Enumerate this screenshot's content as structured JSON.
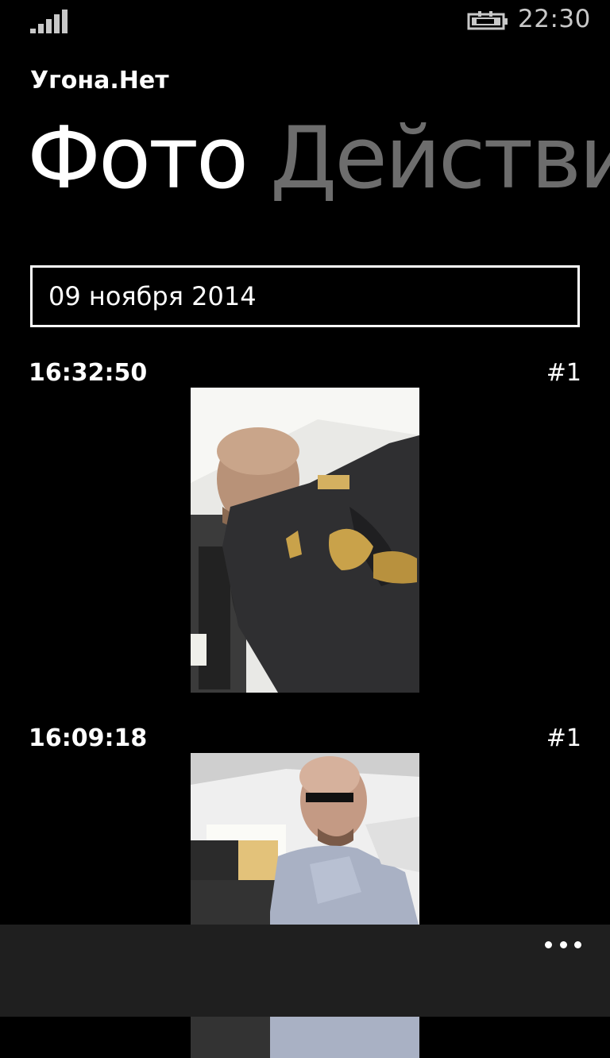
{
  "status": {
    "time": "22:30",
    "signal_icon": "signal-strength-icon",
    "battery_icon": "battery-charging-icon"
  },
  "app": {
    "title": "Угона.Нет"
  },
  "pivot": {
    "items": [
      {
        "label": "Фото",
        "active": true
      },
      {
        "label": "Действия",
        "active": false
      }
    ]
  },
  "date_picker": {
    "value": "09 ноября 2014"
  },
  "entries": [
    {
      "time": "16:32:50",
      "number": "#1",
      "photo_icon": "photo-thumbnail"
    },
    {
      "time": "16:09:18",
      "number": "#1",
      "photo_icon": "photo-thumbnail"
    }
  ],
  "app_bar": {
    "more_icon": "ellipsis-icon"
  },
  "colors": {
    "background": "#000000",
    "foreground": "#ffffff",
    "inactive": "#6d6d6d",
    "app_bar": "#1f1f1f"
  }
}
